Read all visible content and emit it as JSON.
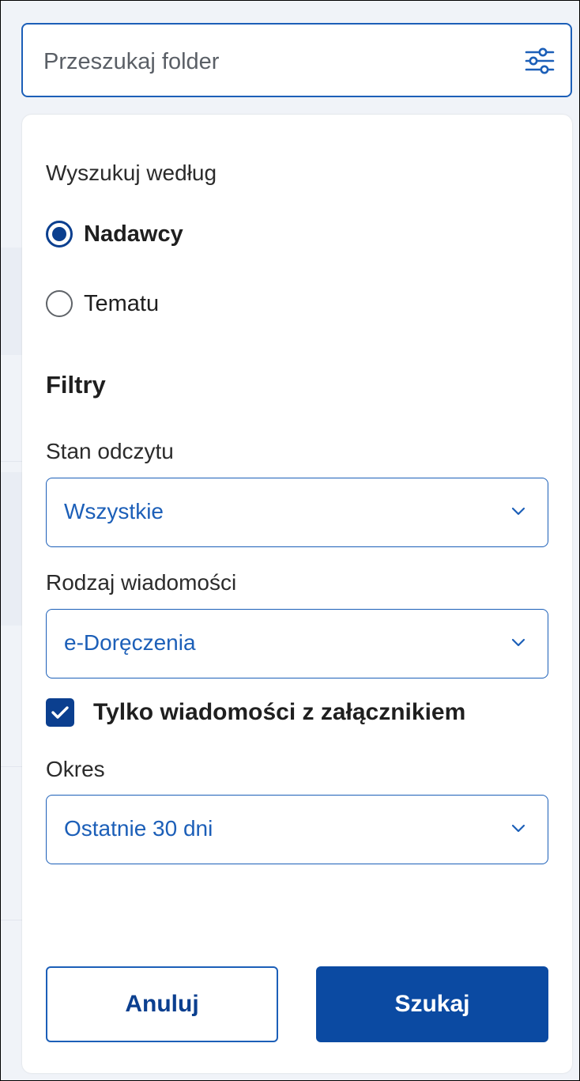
{
  "search": {
    "placeholder": "Przeszukaj folder",
    "filter_icon": "sliders-icon"
  },
  "search_by": {
    "label": "Wyszukuj według",
    "options": [
      {
        "label": "Nadawcy",
        "selected": true
      },
      {
        "label": "Tematu",
        "selected": false
      }
    ]
  },
  "filters": {
    "title": "Filtry",
    "read_state": {
      "label": "Stan odczytu",
      "value": "Wszystkie"
    },
    "message_type": {
      "label": "Rodzaj wiadomości",
      "value": "e-Doręczenia"
    },
    "attachments_only": {
      "label": "Tylko wiadomości z załącznikiem",
      "checked": true
    },
    "period": {
      "label": "Okres",
      "value": "Ostatnie 30 dni"
    }
  },
  "actions": {
    "cancel_label": "Anuluj",
    "search_label": "Szukaj"
  },
  "colors": {
    "accent": "#1c5fb8",
    "primary_dark": "#0b3f8f",
    "panel_bg": "#ffffff",
    "page_bg": "#f0f3f8"
  }
}
